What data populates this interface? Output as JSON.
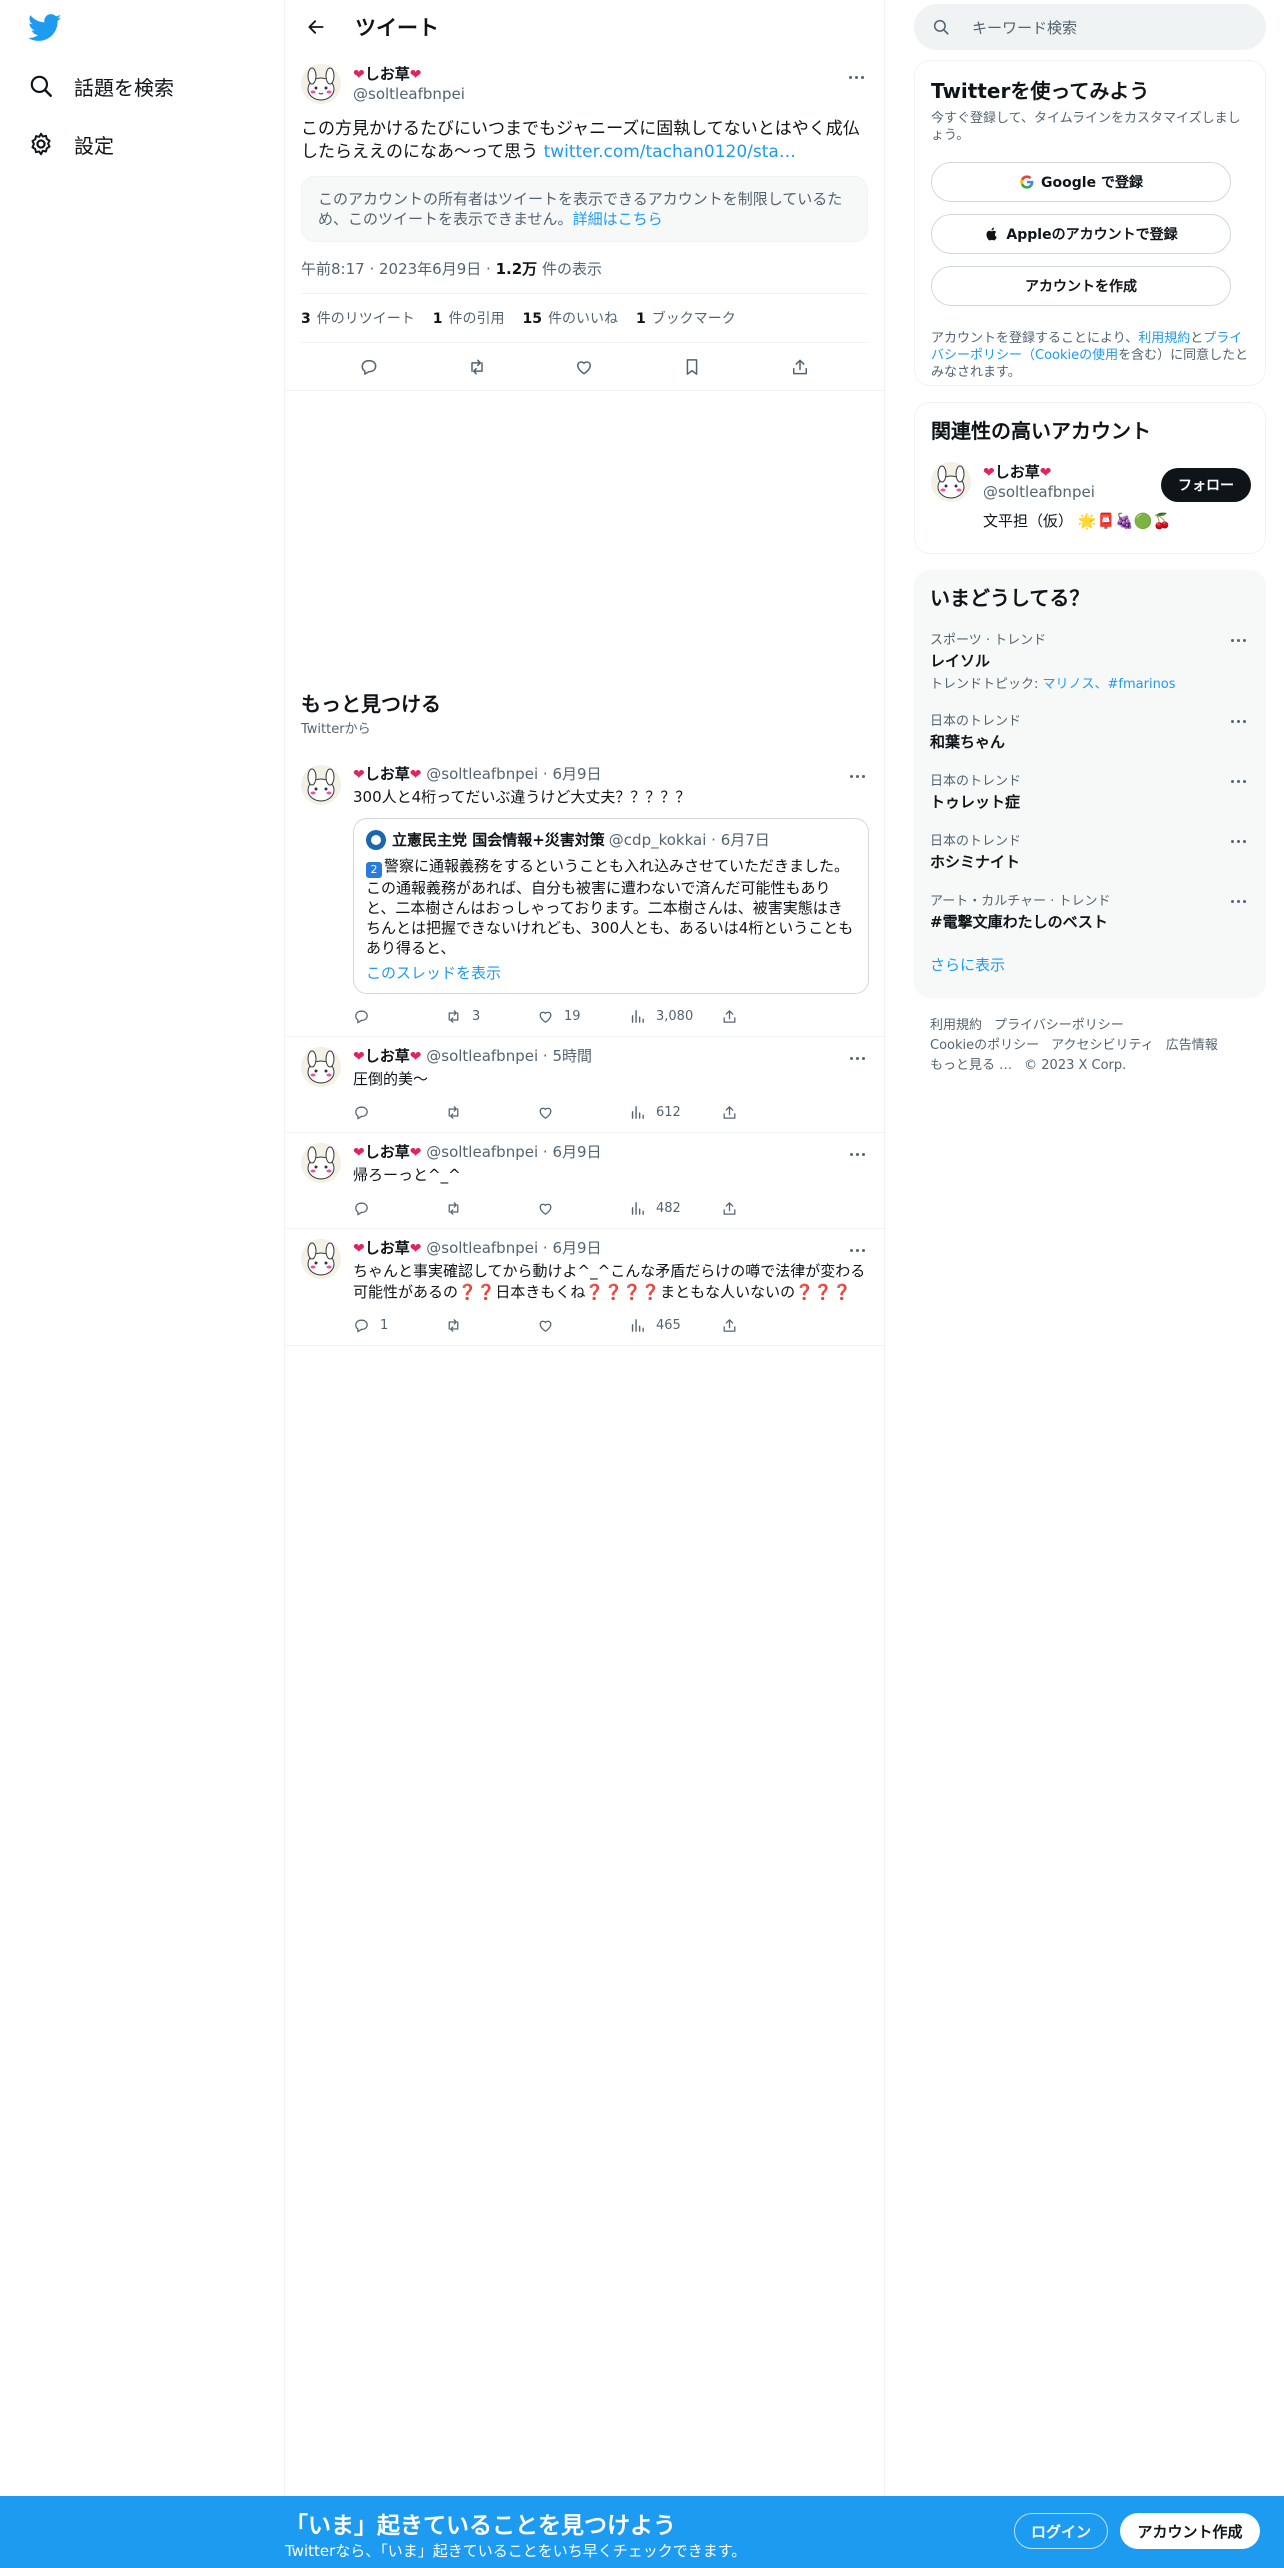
{
  "colors": {
    "accent": "#1d9bf0",
    "text": "#0f1419",
    "muted": "#536471",
    "heart": "#e0245e"
  },
  "nav": {
    "explore_label": "話題を検索",
    "settings_label": "設定"
  },
  "header": {
    "title": "ツイート"
  },
  "tweet": {
    "name": "しお草",
    "handle": "@soltleafbnpei",
    "text": "この方見かけるたびにいつまでもジャニーズに固執してないとはやく成仏したらええのになあ〜って思う ",
    "link": "twitter.com/tachan0120/sta…",
    "restricted_text": "このアカウントの所有者はツイートを表示できるアカウントを制限しているため、このツイートを表示できません。",
    "restricted_link": "詳細はこちら",
    "time": "午前8:17",
    "date": "2023年6月9日",
    "views_num": "1.2万",
    "views_label": "件の表示",
    "retweets_num": "3",
    "retweets_label": "件のリツイート",
    "quotes_num": "1",
    "quotes_label": "件の引用",
    "likes_num": "15",
    "likes_label": "件のいいね",
    "bookmarks_num": "1",
    "bookmarks_label": "ブックマーク"
  },
  "discover": {
    "title": "もっと見つける",
    "subtitle": "Twitterから"
  },
  "feed": [
    {
      "name": "しお草",
      "handle": "@soltleafbnpei",
      "time": "6月9日",
      "text": "300人と4桁ってだいぶ違うけど大丈夫？？？？？",
      "quote": {
        "name": "立憲民主党 国会情報+災害対策",
        "handle": "@cdp_kokkai",
        "time": "6月7日",
        "text": "警察に通報義務をするということも入れ込みさせていただきました。この通報義務があれば、自分も被害に遭わないで済んだ可能性もありと、二本樹さんはおっしゃっております。二本樹さんは、被害実態はきちんとは把握できないけれども、300人とも、あるいは4桁ということもあり得ると、",
        "keycap": "2",
        "thread_link": "このスレッドを表示"
      },
      "replies": "",
      "retweets": "3",
      "likes": "19",
      "views": "3,080"
    },
    {
      "name": "しお草",
      "handle": "@soltleafbnpei",
      "time": "5時間",
      "text": "圧倒的美〜",
      "replies": "",
      "retweets": "",
      "likes": "",
      "views": "612"
    },
    {
      "name": "しお草",
      "handle": "@soltleafbnpei",
      "time": "6月9日",
      "text": "帰ろーっと^_^",
      "replies": "",
      "retweets": "",
      "likes": "",
      "views": "482"
    },
    {
      "name": "しお草",
      "handle": "@soltleafbnpei",
      "time": "6月9日",
      "text_a": "ちゃんと事実確認してから動けよ^_^こんな矛盾だらけの噂で法律が変わる可能性があるの",
      "text_b": "日本きもくね",
      "text_c": "まともな人いないの",
      "replies": "1",
      "retweets": "",
      "likes": "",
      "views": "465"
    }
  ],
  "right": {
    "search_placeholder": "キーワード検索",
    "signup": {
      "title": "Twitterを使ってみよう",
      "desc": "今すぐ登録して、タイムラインをカスタマイズしましょう。",
      "google": "Google で登録",
      "apple": "Appleのアカウントで登録",
      "create": "アカウントを作成",
      "legal_a": "アカウントを登録することにより、",
      "legal_terms": "利用規約",
      "legal_b": "と",
      "legal_privacy": "プライバシーポリシー",
      "legal_c": "（",
      "legal_cookie": "Cookieの使用",
      "legal_d": "を含む）に同意したとみなされます。"
    },
    "related": {
      "title": "関連性の高いアカウント",
      "name": "しお草",
      "handle": "@soltleafbnpei",
      "follow": "フォロー",
      "bio": "文平担（仮）"
    },
    "trends": {
      "title": "いまどうしてる？",
      "items": [
        {
          "category": "スポーツ · トレンド",
          "name": "レイソル",
          "sub_label": "トレンドトピック: ",
          "sub_links": "マリノス、#fmarinos"
        },
        {
          "category": "日本のトレンド",
          "name": "和葉ちゃん"
        },
        {
          "category": "日本のトレンド",
          "name": "トゥレット症"
        },
        {
          "category": "日本のトレンド",
          "name": "ホシミナイト"
        },
        {
          "category": "アート・カルチャー · トレンド",
          "name": "#電撃文庫わたしのベスト"
        }
      ],
      "show_more": "さらに表示"
    },
    "footer": [
      "利用規約",
      "プライバシーポリシー",
      "Cookieのポリシー",
      "アクセシビリティ",
      "広告情報",
      "もっと見る …",
      "© 2023 X Corp."
    ]
  },
  "bottom": {
    "title": "「いま」起きていることを見つけよう",
    "subtitle": "Twitterなら、「いま」起きていることをいち早くチェックできます。",
    "login": "ログイン",
    "signup": "アカウント作成"
  }
}
